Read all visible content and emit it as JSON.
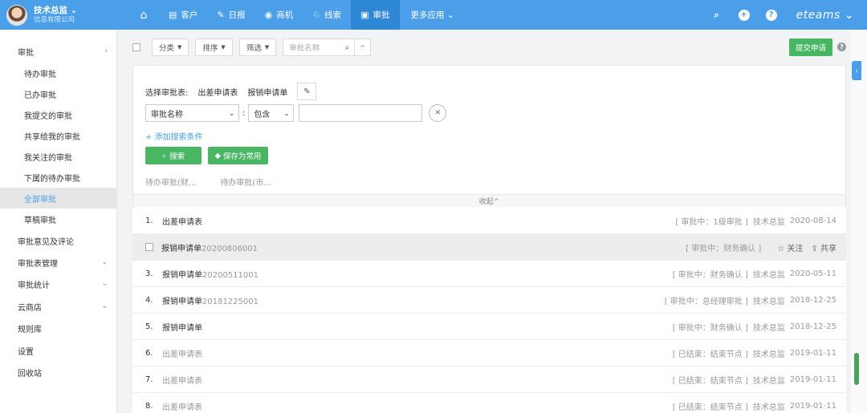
{
  "header": {
    "user_name": "技术总监 ⌄",
    "company": "信息有限公司",
    "nav": [
      {
        "label": "客户",
        "icon": "contacts-icon"
      },
      {
        "label": "日报",
        "icon": "report-icon"
      },
      {
        "label": "商机",
        "icon": "opportunity-icon"
      },
      {
        "label": "线索",
        "icon": "lead-icon"
      },
      {
        "label": "审批",
        "icon": "approval-icon"
      }
    ],
    "more_apps": "更多应用 ⌄",
    "brand": "eteams ⌄"
  },
  "sidebar": {
    "items": [
      {
        "label": "审批"
      },
      {
        "label": "待办审批"
      },
      {
        "label": "已办审批"
      },
      {
        "label": "我提交的审批"
      },
      {
        "label": "共享给我的审批"
      },
      {
        "label": "我关注的审批"
      },
      {
        "label": "下属的待办审批"
      },
      {
        "label": "全部审批"
      },
      {
        "label": "草稿审批"
      },
      {
        "label": "审批意见及评论"
      },
      {
        "label": "审批表管理"
      },
      {
        "label": "审批统计"
      },
      {
        "label": "云商店"
      },
      {
        "label": "规则库"
      },
      {
        "label": "设置"
      },
      {
        "label": "回收站"
      }
    ],
    "active": "全部审批"
  },
  "toolbar": {
    "category": "分类",
    "sort": "排序",
    "filter": "筛选",
    "search_placeholder": "审批名称",
    "submit": "提交申请"
  },
  "filter_panel": {
    "select_label": "选择审批表:",
    "tables": [
      "出差申请表",
      "报销申请单"
    ],
    "field": "审批名称",
    "operator": "包含",
    "add_condition": "+ 添加搜索条件",
    "search_btn": "搜索",
    "save_btn": "保存为常用",
    "saved_filters": [
      "待办审批(财...",
      "待办审批(市..."
    ],
    "collapse": "收起^"
  },
  "list": [
    {
      "num": "1.",
      "title": "出差申请表",
      "code": "",
      "status": "[ 审批中：1级审批 ]",
      "author": "技术总监",
      "date": "2020-08-14",
      "done": false
    },
    {
      "num": "",
      "title": "报销申请单",
      "code": "20200806001",
      "status": "[ 审批中：财务确认 ]",
      "follow": "☆ 关注",
      "share": "⇪ 共享",
      "done": false,
      "highlight": true
    },
    {
      "num": "3.",
      "title": "报销申请单",
      "code": "20200511001",
      "status": "[ 审批中：财务确认 ]",
      "author": "技术总监",
      "date": "2020-05-11",
      "done": false
    },
    {
      "num": "4.",
      "title": "报销申请单",
      "code": "20181225001",
      "status": "[ 审批中：总经理审批 ]",
      "author": "技术总监",
      "date": "2018-12-25",
      "done": false
    },
    {
      "num": "5.",
      "title": "报销申请单",
      "code": "",
      "status": "[ 审批中：财务确认 ]",
      "author": "技术总监",
      "date": "2018-12-25",
      "done": false
    },
    {
      "num": "6.",
      "title": "出差申请表",
      "code": "",
      "status": "[ 已结束：结束节点 ]",
      "author": "技术总监",
      "date": "2019-01-11",
      "done": true
    },
    {
      "num": "7.",
      "title": "出差申请表",
      "code": "",
      "status": "[ 已结束：结束节点 ]",
      "author": "技术总监",
      "date": "2019-01-11",
      "done": true
    },
    {
      "num": "8.",
      "title": "出差申请表",
      "code": "",
      "status": "[ 已结束：结束节点 ]",
      "author": "技术总监",
      "date": "2019-01-11",
      "done": true
    }
  ]
}
